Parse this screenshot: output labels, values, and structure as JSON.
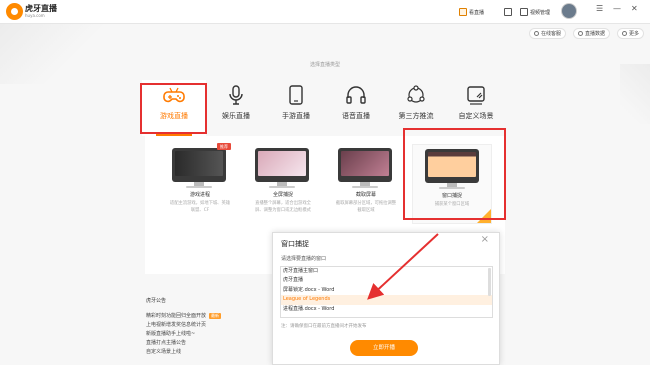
{
  "brand": {
    "name": "虎牙直播",
    "url": "huya.com"
  },
  "topbar": {
    "live_label": "看直播",
    "video_mgmt_label": "视频管理",
    "controls": [
      "☰",
      "—",
      "✕"
    ]
  },
  "right_tools": {
    "support": "在线客服",
    "data": "直播数据",
    "more": "更多"
  },
  "section_title": "选择直播类型",
  "tabs": [
    {
      "label": "游戏直播",
      "icon": "gamepad-icon"
    },
    {
      "label": "娱乐直播",
      "icon": "microphone-icon"
    },
    {
      "label": "手游直播",
      "icon": "phone-icon"
    },
    {
      "label": "语音直播",
      "icon": "headphones-icon"
    },
    {
      "label": "第三方推流",
      "icon": "share-network-icon"
    },
    {
      "label": "自定义场景",
      "icon": "custom-scene-icon"
    }
  ],
  "cards": [
    {
      "name": "游戏进程",
      "desc": "适配主流游戏，如地下城、英雄联盟、CF",
      "hot": "推荐"
    },
    {
      "name": "全屏捕捉",
      "desc": "直播整个屏幕，适合出游戏全屏、调整为窗口或无边框模式"
    },
    {
      "name": "截取屏幕",
      "desc": "截取屏幕部分区域，可拖拉调整截取区域"
    },
    {
      "name": "窗口捕捉",
      "desc": "捕获某个窗口区域"
    }
  ],
  "notice": {
    "title": "虎牙公告",
    "items": [
      {
        "text": "精彩时刻功能回归全面开放",
        "badge": "最新"
      },
      {
        "text": "上电视新增发奖信息统计页"
      },
      {
        "text": "新版直播助手上线啦~"
      },
      {
        "text": "直播打点主播公告"
      },
      {
        "text": "自定义场景上线"
      }
    ]
  },
  "dialog": {
    "title": "窗口捕捉",
    "label": "请选择要直播的窗口",
    "windows": [
      "虎牙直播主窗口",
      "虎牙直播",
      "屏幕锁定.docx - Word",
      "League of Legends",
      "进程直播.docx - Word"
    ],
    "selected_index": 3,
    "hint": "注：请确保窗口在最前方直播间才开始发布",
    "start": "立即开播"
  },
  "colors": {
    "accent": "#ff7a00",
    "annotation": "#e53030"
  }
}
